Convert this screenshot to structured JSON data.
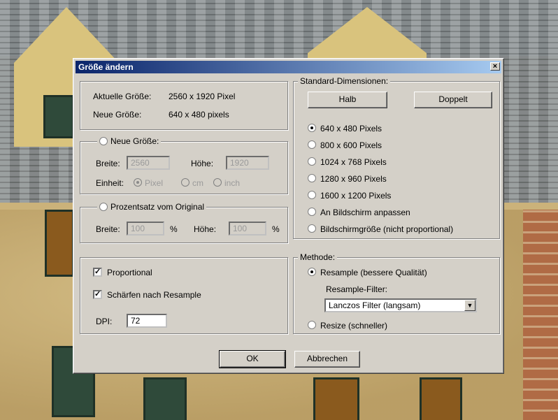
{
  "dialog": {
    "title": "Größe ändern",
    "close_glyph": "×"
  },
  "info": {
    "current_label": "Aktuelle Größe:",
    "current_value": "2560  x  1920  Pixel",
    "new_label": "Neue Größe:",
    "new_value": "640  x  480  pixels"
  },
  "new_size": {
    "radio_label": "Neue Größe:",
    "width_label": "Breite:",
    "width_value": "2560",
    "height_label": "Höhe:",
    "height_value": "1920",
    "unit_label": "Einheit:",
    "unit_options": [
      "Pixel",
      "cm",
      "inch"
    ],
    "unit_selected": "Pixel"
  },
  "percent": {
    "radio_label": "Prozentsatz vom Original",
    "width_label": "Breite:",
    "width_value": "100",
    "height_label": "Höhe:",
    "height_value": "100",
    "unit": "%"
  },
  "options": {
    "proportional_label": "Proportional",
    "proportional_checked": true,
    "sharpen_label": "Schärfen nach Resample",
    "sharpen_checked": true,
    "dpi_label": "DPI:",
    "dpi_value": "72",
    "check_glyph": "✓"
  },
  "standard": {
    "legend": "Standard-Dimensionen:",
    "half_button": "Halb",
    "double_button": "Doppelt",
    "choices": [
      "640 x 480 Pixels",
      "800 x 600 Pixels",
      "1024 x 768 Pixels",
      "1280 x 960 Pixels",
      "1600 x 1200 Pixels",
      "An Bildschirm anpassen",
      "Bildschirmgröße (nicht proportional)"
    ],
    "selected_index": 0
  },
  "method": {
    "legend": "Methode:",
    "resample_label": "Resample (bessere Qualität)",
    "filter_label": "Resample-Filter:",
    "filter_value": "Lanczos Filter (langsam)",
    "resize_label": "Resize (schneller)",
    "selected": "resample"
  },
  "footer": {
    "ok_label": "OK",
    "cancel_label": "Abbrechen"
  }
}
